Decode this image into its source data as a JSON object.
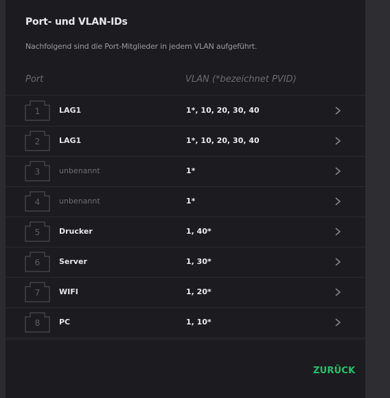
{
  "dialog": {
    "title": "Port- und VLAN-IDs",
    "subtitle": "Nachfolgend sind die Port-Mitglieder in jedem VLAN aufgeführt.",
    "header_port": "Port",
    "header_vlan": "VLAN (*bezeichnet PVID)",
    "back_label": "ZURÜCK"
  },
  "colors": {
    "accent": "#21c46b",
    "dialog_bg": "#1c1b1f"
  },
  "ports": [
    {
      "number": "1",
      "name": "LAG1",
      "vlans": "1*, 10, 20, 30, 40",
      "named": true
    },
    {
      "number": "2",
      "name": "LAG1",
      "vlans": "1*, 10, 20, 30, 40",
      "named": true
    },
    {
      "number": "3",
      "name": "unbenannt",
      "vlans": "1*",
      "named": false
    },
    {
      "number": "4",
      "name": "unbenannt",
      "vlans": "1*",
      "named": false
    },
    {
      "number": "5",
      "name": "Drucker",
      "vlans": "1, 40*",
      "named": true
    },
    {
      "number": "6",
      "name": "Server",
      "vlans": "1, 30*",
      "named": true
    },
    {
      "number": "7",
      "name": "WIFI",
      "vlans": "1, 20*",
      "named": true
    },
    {
      "number": "8",
      "name": "PC",
      "vlans": "1, 10*",
      "named": true
    }
  ]
}
